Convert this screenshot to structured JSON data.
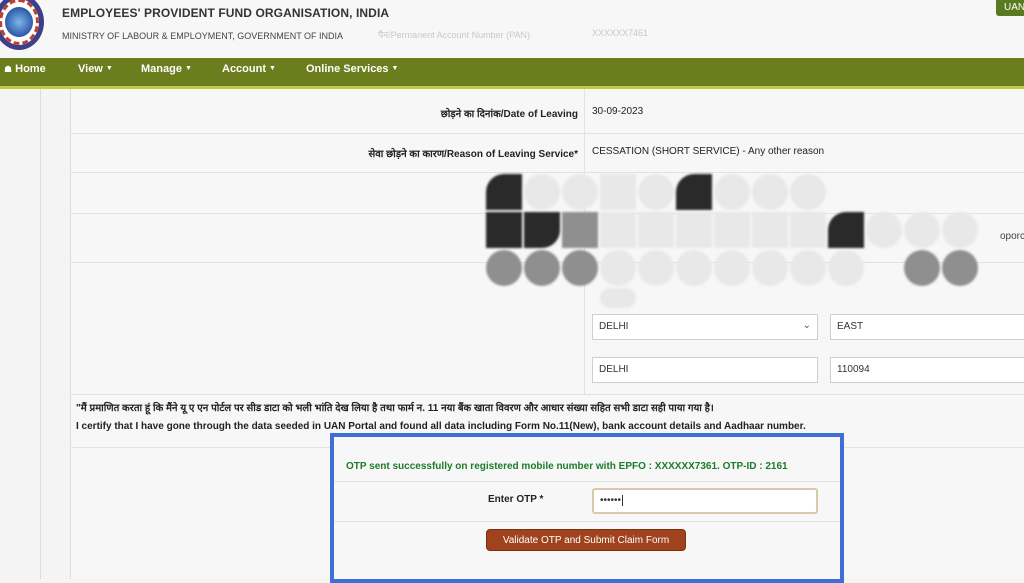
{
  "header": {
    "org_name": "EMPLOYEES' PROVIDENT FUND ORGANISATION, INDIA",
    "ministry": "MINISTRY OF LABOUR & EMPLOYMENT, GOVERNMENT OF INDIA",
    "faint_pan_label": "पैन/Permanent Account Number (PAN)",
    "faint_pan_value": "XXXXXX7461",
    "uan_badge": "UAN"
  },
  "nav": {
    "home": "Home",
    "view": "View",
    "manage": "Manage",
    "account": "Account",
    "online_services": "Online Services"
  },
  "form": {
    "date_of_leaving_label": "छोड़ने का दिनांक/Date of Leaving",
    "date_of_leaving_value": "30-09-2023",
    "reason_label": "सेवा छोड़ने का कारण/Reason of Leaving Service*",
    "reason_value": "CESSATION (SHORT SERVICE) - Any other reason",
    "partial_text": "oporc",
    "state_select": "DELHI",
    "district_input": "EAST",
    "city_input": "DELHI",
    "pincode_input": "110094"
  },
  "declaration": {
    "hindi": "\"मैं प्रमाणित करता हूं कि मैंने यू ए एन पोर्टल पर सीड डाटा को भली भांति देख लिया है तथा फार्म न. 11 नया बैंक खाता विवरण और आधार संख्या सहित सभी डाटा सही पाया गया है।",
    "english": "I certify that I have gone through the data seeded in UAN Portal and found all data including Form No.11(New), bank account details and Aadhaar number."
  },
  "otp": {
    "message": "OTP sent successfully on registered mobile number with EPFO : XXXXXX7361. OTP-ID : 2161",
    "label": "Enter OTP *",
    "value": "••••••",
    "submit_label": "Validate OTP and Submit Claim Form"
  }
}
